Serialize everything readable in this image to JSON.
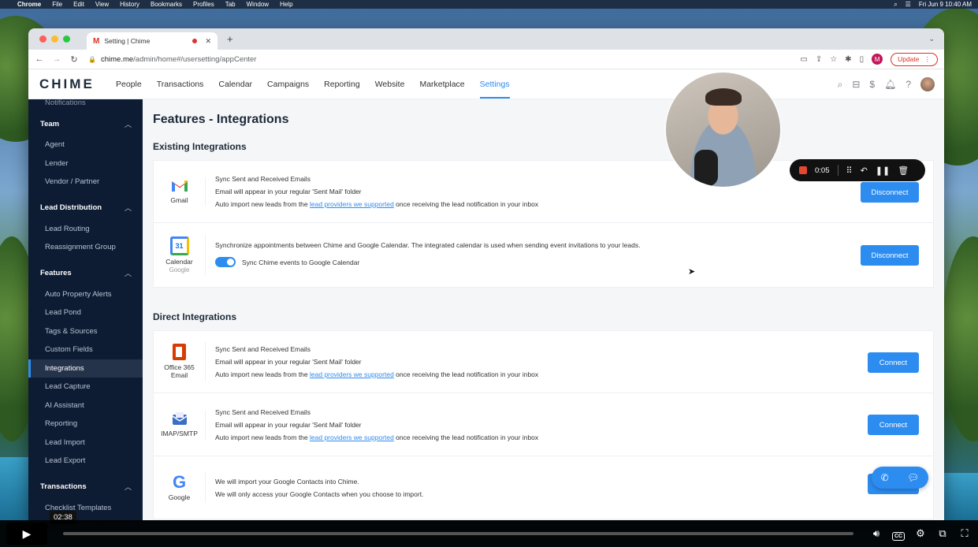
{
  "mac_menubar": {
    "app": "Chrome",
    "menus": [
      "File",
      "Edit",
      "View",
      "History",
      "Bookmarks",
      "Profiles",
      "Tab",
      "Window",
      "Help"
    ],
    "clock": "Fri Jun 9  10:40 AM"
  },
  "browser": {
    "tab_title": "Setting | Chime",
    "url_host": "chime.me",
    "url_path": "/admin/home#/usersetting/appCenter",
    "update_label": "Update",
    "profile_initial": "M"
  },
  "app": {
    "logo": "CHIME",
    "nav": [
      "People",
      "Transactions",
      "Calendar",
      "Campaigns",
      "Reporting",
      "Website",
      "Marketplace",
      "Settings"
    ],
    "active_nav": "Settings"
  },
  "sidebar": {
    "clipped_item": "Notifications",
    "sections": [
      {
        "title": "Team",
        "items": [
          "Agent",
          "Lender",
          "Vendor / Partner"
        ]
      },
      {
        "title": "Lead Distribution",
        "items": [
          "Lead Routing",
          "Reassignment Group"
        ]
      },
      {
        "title": "Features",
        "items": [
          "Auto Property Alerts",
          "Lead Pond",
          "Tags & Sources",
          "Custom Fields",
          "Integrations",
          "Lead Capture",
          "AI Assistant",
          "Reporting",
          "Lead Import",
          "Lead Export"
        ]
      },
      {
        "title": "Transactions",
        "items": [
          "Checklist Templates"
        ]
      }
    ],
    "active_item": "Integrations"
  },
  "page": {
    "title": "Features - Integrations",
    "existing_title": "Existing Integrations",
    "direct_title": "Direct Integrations",
    "existing": [
      {
        "name": "Gmail",
        "sub": "",
        "lines": [
          "Sync Sent and Received Emails",
          "Email will appear in your regular 'Sent Mail' folder"
        ],
        "link_line": {
          "before": "Auto import new leads from the ",
          "link": "lead providers we supported",
          "after": " once receiving the lead notification in your inbox"
        },
        "button": "Disconnect"
      },
      {
        "name": "Calendar",
        "sub": "Google",
        "icon_day": "31",
        "lines": [
          "Synchronize appointments between Chime and Google Calendar. The integrated calendar is used when sending event invitations to your leads."
        ],
        "toggle_label": "Sync Chime events to Google Calendar",
        "button": "Disconnect"
      }
    ],
    "direct": [
      {
        "name": "Office 365 Email",
        "lines": [
          "Sync Sent and Received Emails",
          "Email will appear in your regular 'Sent Mail' folder"
        ],
        "link_line": {
          "before": "Auto import new leads from the ",
          "link": "lead providers we supported",
          "after": " once receiving the lead notification in your inbox"
        },
        "button": "Connect"
      },
      {
        "name": "IMAP/SMTP",
        "lines": [
          "Sync Sent and Received Emails",
          "Email will appear in your regular 'Sent Mail' folder"
        ],
        "link_line": {
          "before": "Auto import new leads from the ",
          "link": "lead providers we supported",
          "after": " once receiving the lead notification in your inbox"
        },
        "button": "Connect"
      },
      {
        "name": "Google",
        "lines": [
          "We will import your Google Contacts into Chime.",
          "We will only access your Google Contacts when you choose to import."
        ],
        "button": "Connect"
      }
    ]
  },
  "recorder": {
    "time": "0:05"
  },
  "player": {
    "time_bubble": "02:38",
    "progress": 0.0
  },
  "colors": {
    "accent": "#2d8cf0",
    "sidebar": "#0d1b33",
    "record_red": "#e5482f"
  }
}
